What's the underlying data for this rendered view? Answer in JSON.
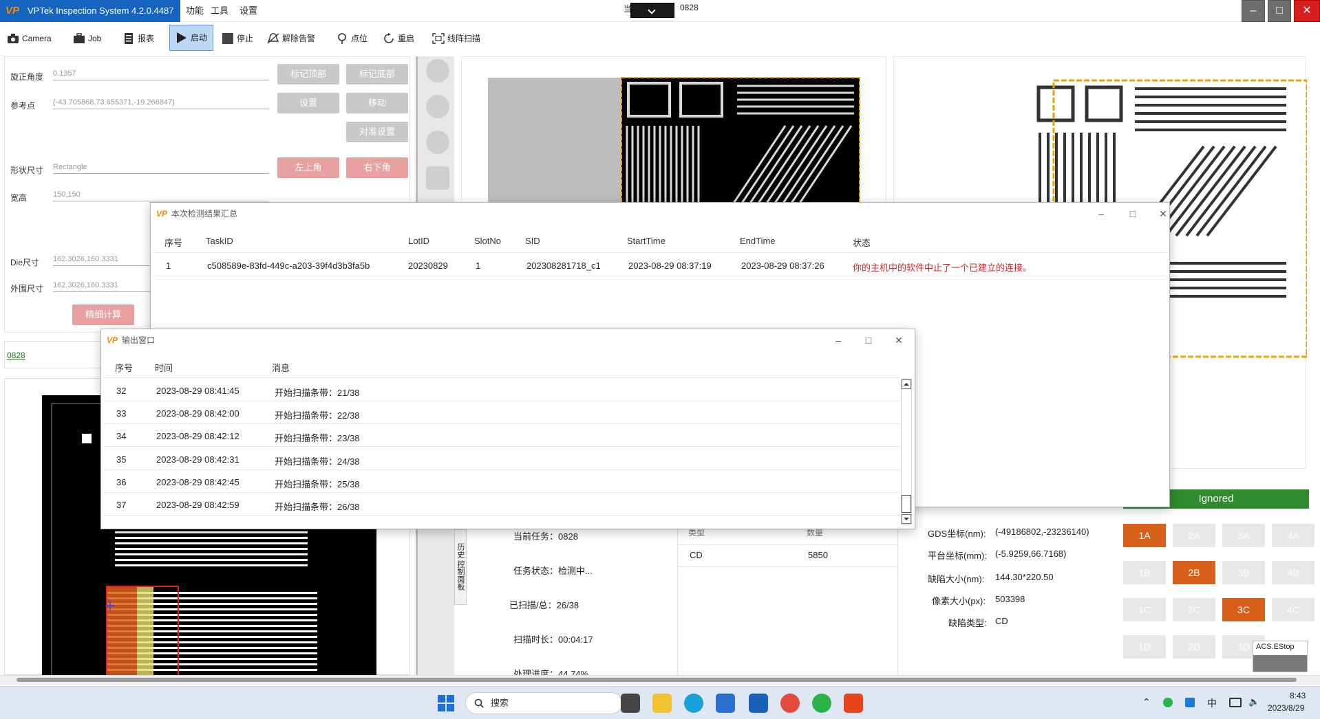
{
  "app": {
    "title": "VPTek Inspection System 4.2.0.4487",
    "logo": "VP",
    "menus": [
      "功能",
      "工具",
      "设置"
    ],
    "title_prefix": "当",
    "title_task": "0828"
  },
  "toolbar": {
    "items": [
      {
        "label": "Camera",
        "icon": "camera-icon"
      },
      {
        "label": "Job",
        "icon": "briefcase-icon"
      },
      {
        "label": "报表",
        "icon": "report-icon"
      },
      {
        "label": "启动",
        "icon": "play-icon"
      },
      {
        "label": "停止",
        "icon": "stop-icon"
      },
      {
        "label": "解除告警",
        "icon": "bell-off-icon"
      },
      {
        "label": "点位",
        "icon": "pin-icon"
      },
      {
        "label": "重启",
        "icon": "refresh-icon"
      },
      {
        "label": "线阵扫描",
        "icon": "scan-icon"
      }
    ]
  },
  "params": {
    "rotation_label": "旋正角度",
    "rotation_value": "0.1357",
    "ref_label": "参考点",
    "ref_value": "(-43.705868,73.655371,-19.266847)",
    "shape_label": "形状尺寸",
    "shape_value": "Rectangle",
    "wh_label": "宽高",
    "wh_value": "150,150",
    "die_label": "Die尺寸",
    "die_value": "162.3026,160.3331",
    "outer_label": "外围尺寸",
    "outer_value": "162.3026,160.3331",
    "btn_mark_top": "标记顶部",
    "btn_mark_bottom": "标记底部",
    "btn_set": "设置",
    "btn_move": "移动",
    "btn_align": "对准设置",
    "btn_top_left": "左上角",
    "btn_bottom_right": "右下角",
    "btn_fine_calc": "精细计算",
    "task_link": "0828"
  },
  "result_dialog": {
    "title": "本次检测结果汇总",
    "columns": [
      "序号",
      "TaskID",
      "LotID",
      "SlotNo",
      "SID",
      "StartTime",
      "EndTime",
      "状态"
    ],
    "rows": [
      [
        "1",
        "c508589e-83fd-449c-a203-39f4d3b3fa5b",
        "20230829",
        "1",
        "202308281718_c1",
        "2023-08-29 08:37:19",
        "2023-08-29 08:37:26",
        "你的主机中的软件中止了一个已建立的连接。"
      ]
    ]
  },
  "output_dialog": {
    "title": "输出窗口",
    "columns": [
      "序号",
      "时间",
      "消息"
    ],
    "rows": [
      [
        "32",
        "2023-08-29 08:41:45",
        "开始扫描条带：21/38"
      ],
      [
        "33",
        "2023-08-29 08:42:00",
        "开始扫描条带：22/38"
      ],
      [
        "34",
        "2023-08-29 08:42:12",
        "开始扫描条带：23/38"
      ],
      [
        "35",
        "2023-08-29 08:42:31",
        "开始扫描条带：24/38"
      ],
      [
        "36",
        "2023-08-29 08:42:45",
        "开始扫描条带：25/38"
      ],
      [
        "37",
        "2023-08-29 08:42:59",
        "开始扫描条带：26/38"
      ]
    ]
  },
  "status": {
    "tab_history": "历史",
    "tab_control": "控制面板",
    "current_task": "当前任务：0828",
    "task_state": "任务状态：检测中...",
    "scanned": "已扫描/总：26/38",
    "scan_time": "扫描时长：00:04:17",
    "progress": "处理进度：44.74%",
    "col_type": "类型",
    "col_count": "数量",
    "defect_type": "CD",
    "defect_count": "5850"
  },
  "defect": {
    "gds_label": "GDS坐标(nm):",
    "gds_value": "(-49186802,-23236140)",
    "stage_label": "平台坐标(mm):",
    "stage_value": "(-5.9259,66.7168)",
    "size_label": "缺陷大小(nm):",
    "size_value": "144.30*220.50",
    "px_label": "像素大小(px):",
    "px_value": "503398",
    "type_label": "缺陷类型:",
    "type_value": "CD",
    "ignored": "Ignored",
    "grid": [
      "1A",
      "2A",
      "3A",
      "4A",
      "1B",
      "2B",
      "3B",
      "4B",
      "1C",
      "2C",
      "3C",
      "4C",
      "1D",
      "2D",
      "3D"
    ],
    "estop": "ACS.EStop"
  },
  "taskbar": {
    "search": "搜索",
    "ime": "中",
    "time": "8:43",
    "date": "2023/8/29"
  },
  "colors": {
    "accent": "#1565c0",
    "alert_red": "#e02020",
    "grid_on": "#d8601a",
    "ignored_green": "#2e8b2e",
    "disabled_btn": "#c8c8c8",
    "red_btn": "#e8a0a0"
  }
}
